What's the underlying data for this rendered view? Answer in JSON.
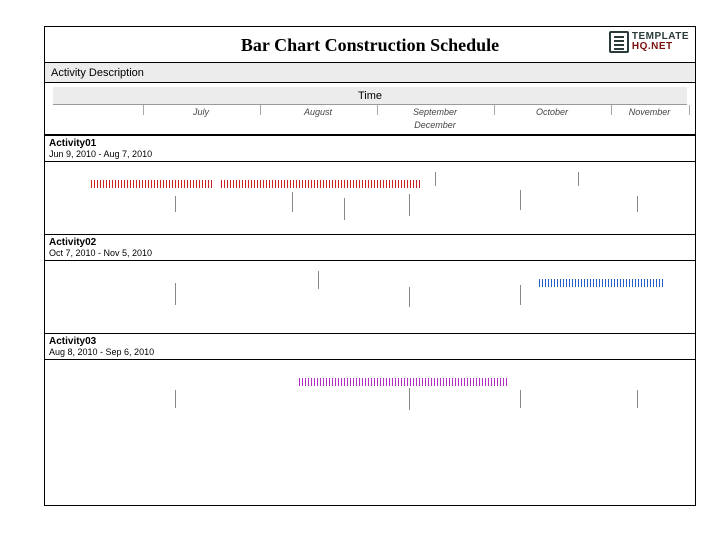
{
  "header": {
    "title": "Bar Chart Construction Schedule",
    "logo_line1": "TEMPLATE",
    "logo_line2": "HQ.NET"
  },
  "labels": {
    "activity_description": "Activity Description",
    "time": "Time"
  },
  "months": {
    "visible": [
      "July",
      "August",
      "September",
      "October",
      "November"
    ],
    "overflow": "December"
  },
  "activities": [
    {
      "name": "Activity01",
      "range": "Jun 9, 2010 - Aug 7, 2010",
      "color": "#cc1f1f",
      "start_pct": 7,
      "end_pct": 58
    },
    {
      "name": "Activity02",
      "range": "Oct 7, 2010 - Nov 5, 2010",
      "color": "#1f5fcc",
      "start_pct": 76,
      "end_pct": 95
    },
    {
      "name": "Activity03",
      "range": "Aug 8, 2010 - Sep 6, 2010",
      "color": "#b02fc0",
      "start_pct": 39,
      "end_pct": 71
    }
  ],
  "chart_data": {
    "type": "bar",
    "title": "Bar Chart Construction Schedule",
    "xlabel": "Time",
    "ylabel": "Activity Description",
    "categories": [
      "Activity01",
      "Activity02",
      "Activity03"
    ],
    "series": [
      {
        "name": "Activity01",
        "start": "2010-06-09",
        "end": "2010-08-07",
        "label": "Jun 9, 2010 - Aug 7, 2010"
      },
      {
        "name": "Activity02",
        "start": "2010-10-07",
        "end": "2010-11-05",
        "label": "Oct 7, 2010 - Nov 5, 2010"
      },
      {
        "name": "Activity03",
        "start": "2010-08-08",
        "end": "2010-09-06",
        "label": "Aug 8, 2010 - Sep 6, 2010"
      }
    ],
    "x_axis_months": [
      "July",
      "August",
      "September",
      "October",
      "November",
      "December"
    ],
    "x_range": [
      "2010-06-01",
      "2010-12-31"
    ]
  }
}
